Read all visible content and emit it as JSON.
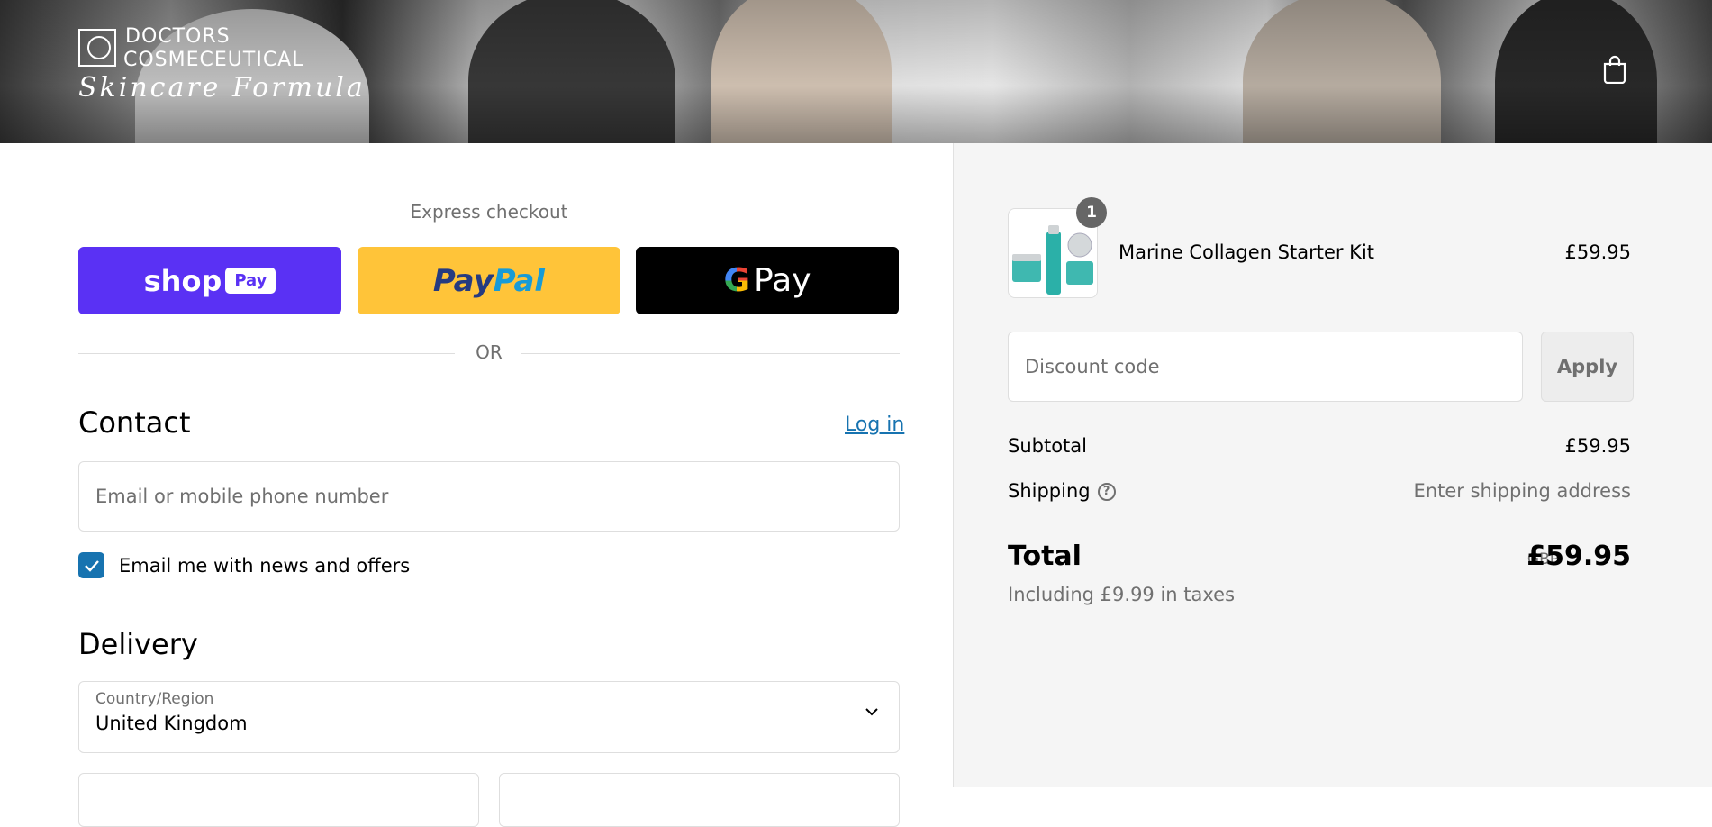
{
  "header": {
    "logo_line1": "DOCTORS",
    "logo_line2": "COSMECEUTICAL",
    "logo_script": "Skincare Formula",
    "cart_icon": "shopping-bag-icon"
  },
  "express": {
    "title": "Express checkout",
    "shop_label": "shop",
    "shop_pill": "Pay",
    "paypal_part1": "Pay",
    "paypal_part2": "Pal",
    "gpay_g": "G",
    "gpay_label": "Pay",
    "or": "OR"
  },
  "contact": {
    "heading": "Contact",
    "login": "Log in",
    "email_placeholder": "Email or mobile phone number",
    "newsletter_label": "Email me with news and offers",
    "newsletter_checked": true
  },
  "delivery": {
    "heading": "Delivery",
    "country_label": "Country/Region",
    "country_value": "United Kingdom"
  },
  "summary": {
    "product_name": "Marine Collagen Starter Kit",
    "product_qty": "1",
    "product_price": "£59.95",
    "discount_placeholder": "Discount code",
    "apply": "Apply",
    "subtotal_label": "Subtotal",
    "subtotal_value": "£59.95",
    "shipping_label": "Shipping",
    "shipping_value": "Enter shipping address",
    "total_label": "Total",
    "currency": "GBP",
    "total_value": "£59.95",
    "tax_note": "Including £9.99 in taxes"
  },
  "colors": {
    "accent": "#1773b0",
    "shop_pay": "#5a31f4",
    "paypal": "#ffc439",
    "summary_bg": "#f5f5f5"
  }
}
